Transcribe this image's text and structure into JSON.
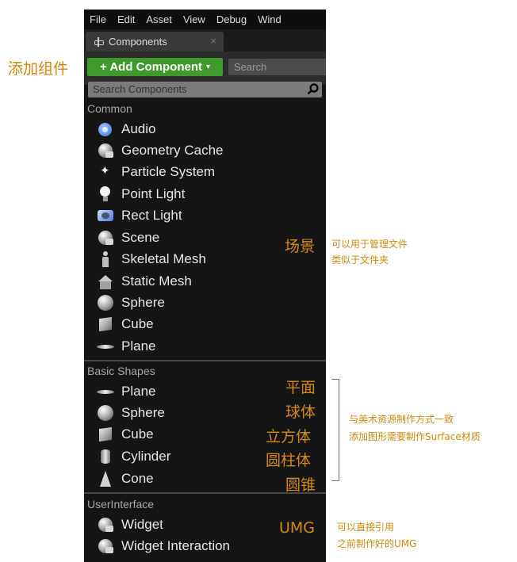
{
  "menu": [
    "File",
    "Edit",
    "Asset",
    "View",
    "Debug",
    "Wind"
  ],
  "tab": {
    "label": "Components",
    "close": "×"
  },
  "toolbar": {
    "add_label": "+ Add Component",
    "add_dropdown": "▾",
    "search_placeholder": "Search"
  },
  "component_search": {
    "placeholder": "Search Components"
  },
  "sections": {
    "common": {
      "title": "Common",
      "items": [
        {
          "label": "Audio",
          "icon": "audio-icon"
        },
        {
          "label": "Geometry Cache",
          "icon": "geometry-cache-icon"
        },
        {
          "label": "Particle System",
          "icon": "particle-icon"
        },
        {
          "label": "Point Light",
          "icon": "point-light-icon"
        },
        {
          "label": "Rect Light",
          "icon": "rect-light-icon"
        },
        {
          "label": "Scene",
          "icon": "scene-icon"
        },
        {
          "label": "Skeletal Mesh",
          "icon": "skeletal-mesh-icon"
        },
        {
          "label": "Static Mesh",
          "icon": "static-mesh-icon"
        },
        {
          "label": "Sphere",
          "icon": "sphere-icon"
        },
        {
          "label": "Cube",
          "icon": "cube-icon"
        },
        {
          "label": "Plane",
          "icon": "plane-icon"
        }
      ]
    },
    "basic_shapes": {
      "title": "Basic Shapes",
      "items": [
        {
          "label": "Plane",
          "icon": "plane-icon"
        },
        {
          "label": "Sphere",
          "icon": "sphere-icon"
        },
        {
          "label": "Cube",
          "icon": "cube-icon"
        },
        {
          "label": "Cylinder",
          "icon": "cylinder-icon"
        },
        {
          "label": "Cone",
          "icon": "cone-icon"
        }
      ]
    },
    "user_interface": {
      "title": "UserInterface",
      "items": [
        {
          "label": "Widget",
          "icon": "widget-icon"
        },
        {
          "label": "Widget Interaction",
          "icon": "widget-interaction-icon"
        }
      ]
    }
  },
  "annotations": {
    "add_component": "添加组件",
    "scene": "场景",
    "scene_note_1": "可以用于管理文件",
    "scene_note_2": "类似于文件夹",
    "shape_plane": "平面",
    "shape_sphere": "球体",
    "shape_cube": "立方体",
    "shape_cylinder": "圆柱体",
    "shape_cone": "圆锥",
    "shapes_note_1": "与美术资源制作方式一致",
    "shapes_note_2": "添加图形需要制作Surface材质",
    "umg": "UMG",
    "umg_note_1": "可以直接引用",
    "umg_note_2": "之前制作好的UMG"
  },
  "colors": {
    "accent_green": "#3f9a2b",
    "annotation": "#d48a0f",
    "panel_bg": "#151515"
  }
}
